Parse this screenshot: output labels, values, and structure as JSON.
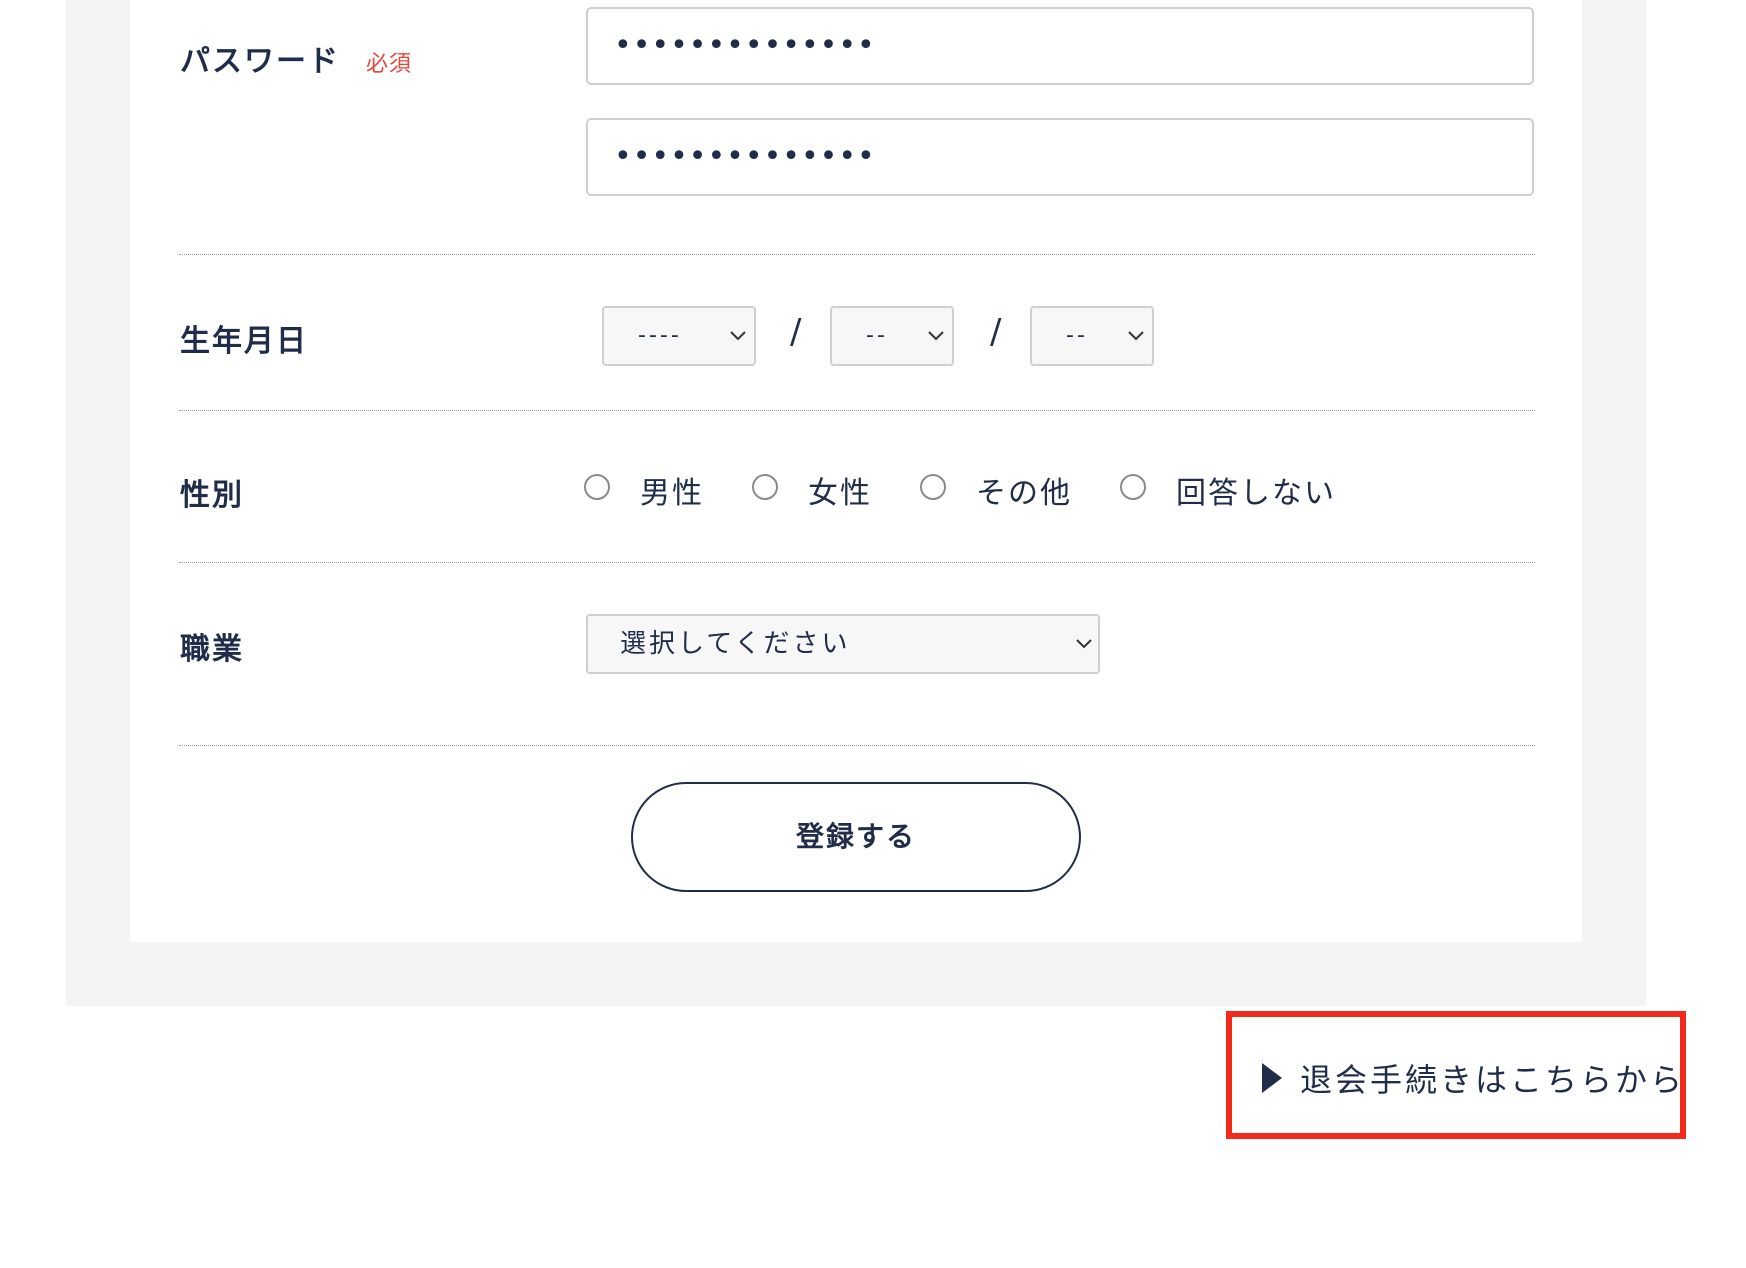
{
  "password": {
    "label": "パスワード",
    "required": "必須",
    "value": "••••••••••••••",
    "confirm_value": "••••••••••••••"
  },
  "birthday": {
    "label": "生年月日",
    "year": "----",
    "month": "--",
    "day": "--",
    "separator": "/"
  },
  "gender": {
    "label": "性別",
    "options": [
      "男性",
      "女性",
      "その他",
      "回答しない"
    ]
  },
  "occupation": {
    "label": "職業",
    "value": "選択してください"
  },
  "submit_label": "登録する",
  "withdraw_link": "退会手続きはこちらから",
  "colors": {
    "text": "#1f2d4a",
    "required": "#e0483c",
    "highlight": "#f22b1a",
    "panel_bg": "#f4f4f4"
  }
}
